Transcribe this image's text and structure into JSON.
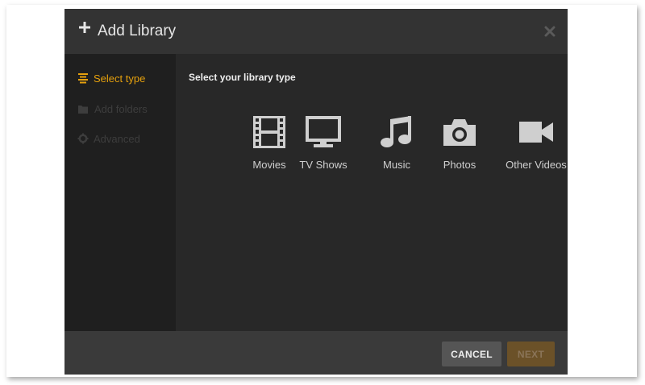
{
  "dialog": {
    "title": "Add Library",
    "close_icon": "close-icon"
  },
  "sidebar": {
    "items": [
      {
        "label": "Select type",
        "icon": "list-icon",
        "state": "active"
      },
      {
        "label": "Add folders",
        "icon": "folder-icon",
        "state": "disabled"
      },
      {
        "label": "Advanced",
        "icon": "gear-icon",
        "state": "disabled"
      }
    ]
  },
  "main": {
    "prompt": "Select your library type",
    "types": [
      {
        "label": "Movies",
        "icon": "film-icon"
      },
      {
        "label": "TV Shows",
        "icon": "tv-icon"
      },
      {
        "label": "Music",
        "icon": "music-note-icon"
      },
      {
        "label": "Photos",
        "icon": "camera-icon"
      },
      {
        "label": "Other Videos",
        "icon": "video-camera-icon"
      }
    ]
  },
  "footer": {
    "cancel_label": "CANCEL",
    "next_label": "NEXT"
  },
  "colors": {
    "accent": "#e5a00d",
    "header_bg": "#333333",
    "sidebar_bg": "#1f1f1f",
    "main_bg": "#282828",
    "footer_bg": "#3a3a3a"
  }
}
